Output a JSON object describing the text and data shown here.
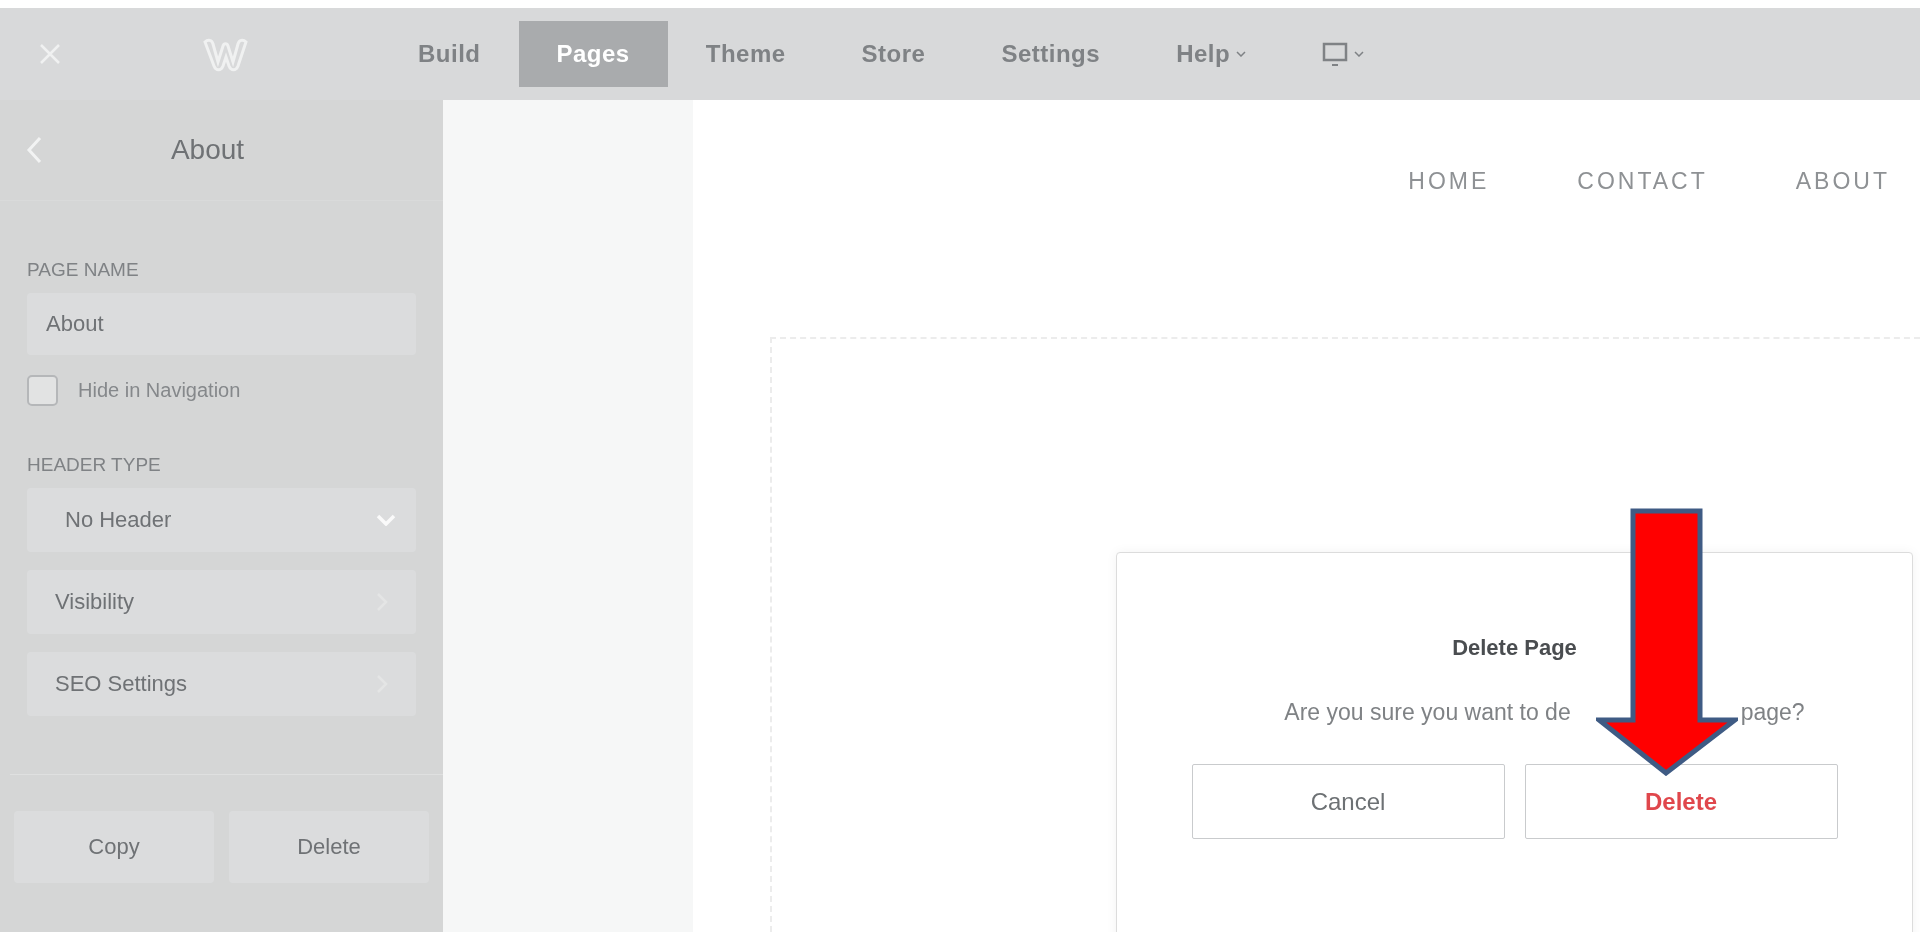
{
  "topbar": {
    "nav": [
      {
        "label": "Build",
        "selected": false,
        "kind": "text"
      },
      {
        "label": "Pages",
        "selected": true,
        "kind": "text"
      },
      {
        "label": "Theme",
        "selected": false,
        "kind": "text"
      },
      {
        "label": "Store",
        "selected": false,
        "kind": "text"
      },
      {
        "label": "Settings",
        "selected": false,
        "kind": "text"
      },
      {
        "label": "Help",
        "selected": false,
        "kind": "menu"
      },
      {
        "selected": false,
        "kind": "device"
      }
    ]
  },
  "sidebar": {
    "title": "About",
    "page_name_label": "PAGE NAME",
    "page_name_value": "About",
    "hide_in_navigation": {
      "label": "Hide in Navigation",
      "checked": false
    },
    "header_type_label": "HEADER TYPE",
    "header_type": "No Header",
    "rows": [
      "Visibility",
      "SEO Settings"
    ],
    "buttons": [
      "Copy",
      "Delete"
    ]
  },
  "site_nav": [
    "HOME",
    "CONTACT",
    "ABOUT"
  ],
  "dialog": {
    "title": "Delete Page",
    "message_parts": [
      "Are you sure you want to de",
      "page?"
    ],
    "buttons": [
      {
        "label": "Cancel",
        "kind": "cancel"
      },
      {
        "label": "Delete",
        "kind": "danger"
      }
    ]
  }
}
